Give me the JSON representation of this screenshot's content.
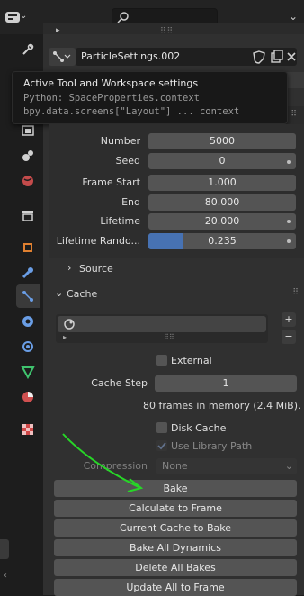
{
  "header": {
    "editor_type_icon": "properties-editor-icon",
    "search_icon": "search-icon",
    "collapse_icon": "chevron-down-icon"
  },
  "id_block": {
    "name": "ParticleSettings.002",
    "icons": [
      "fake-user-shield-icon",
      "duplicate-icon",
      "close-icon"
    ]
  },
  "tooltip": {
    "title": "Active Tool and Workspace settings",
    "python": "Python: SpaceProperties.context",
    "path": "bpy.data.screens[\"Layout\"] ... context"
  },
  "settings": {
    "number": {
      "label": "Number",
      "value": "5000"
    },
    "seed": {
      "label": "Seed",
      "value": "0"
    },
    "frame_start": {
      "label": "Frame Start",
      "value": "1.000"
    },
    "end": {
      "label": "End",
      "value": "80.000"
    },
    "lifetime": {
      "label": "Lifetime",
      "value": "20.000"
    },
    "lifetime_random": {
      "label": "Lifetime Rando...",
      "value": "0.235",
      "fraction": 0.235
    }
  },
  "source": {
    "label": "Source"
  },
  "cache": {
    "label": "Cache",
    "external": "External",
    "cache_step": {
      "label": "Cache Step",
      "value": "1"
    },
    "memory_info": "80 frames in memory (2.4 MiB).",
    "disk_cache": "Disk Cache",
    "use_library_path": "Use Library Path",
    "compression": {
      "label": "Compression",
      "value": "None"
    }
  },
  "buttons": {
    "bake": "Bake",
    "calculate": "Calculate to Frame",
    "current_cache": "Current Cache to Bake",
    "bake_all": "Bake All Dynamics",
    "delete_all": "Delete All Bakes",
    "update_all": "Update All to Frame"
  },
  "colors": {
    "accent_blue": "#4772b3",
    "annotation_green": "#27d627",
    "panel": "#303030",
    "field": "#545454"
  }
}
